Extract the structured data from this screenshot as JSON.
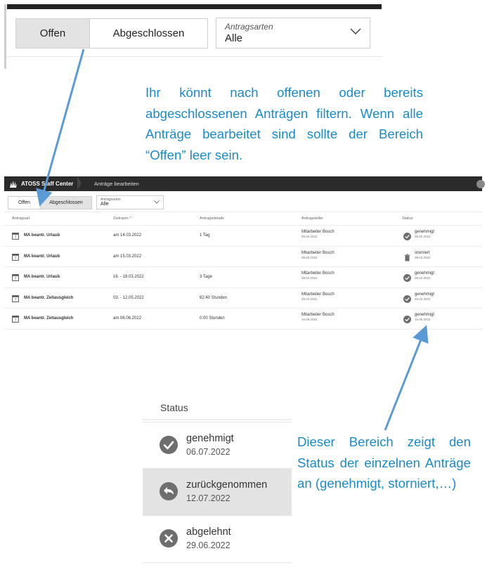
{
  "top_filter": {
    "tab_open": "Offen",
    "tab_closed": "Abgeschlossen",
    "select_label": "Antragsarten",
    "select_value": "Alle"
  },
  "callouts": {
    "filter_note": "Ihr könnt nach offenen oder bereits abgeschlossenen Anträgen filtern. Wenn alle Anträge bearbeitet sind sollte der Bereich “Offen” leer sein.",
    "status_note": "Dieser Bereich zeigt den Status der einzelnen Anträge an (genehmigt, storniert,…)"
  },
  "app": {
    "brand": "ATOSS Staff Center",
    "breadcrumb": "Anträge bearbeiten",
    "filter": {
      "tab_open": "Offen",
      "tab_closed": "Abgeschlossen",
      "select_label": "Antragsarten",
      "select_value": "Alle"
    },
    "columns": [
      "Antragsart",
      "Zeitraum ^",
      "Antragsdetails",
      "Antragsteller",
      "Status"
    ],
    "rows": [
      {
        "type": "MA beantr. Urlaub",
        "period": "am 14.03.2022",
        "details": "1 Tag",
        "requester": "Mitarbeiter Bosch",
        "requester_date": "09.02.2022",
        "status": "genehmigt",
        "status_date": "09.02.2022",
        "status_icon": "check-circle-icon"
      },
      {
        "type": "MA beantr. Urlaub",
        "period": "am 15.03.2022",
        "details": "",
        "requester": "Mitarbeiter Bosch",
        "requester_date": "09.02.2022",
        "status": "storniert",
        "status_date": "09.02.2022",
        "status_icon": "trash-icon"
      },
      {
        "type": "MA beantr. Urlaub",
        "period": "16. - 18.03.2022",
        "details": "3 Tage",
        "requester": "Mitarbeiter Bosch",
        "requester_date": "09.02.2022",
        "status": "genehmigt",
        "status_date": "09.02.2022",
        "status_icon": "check-circle-icon"
      },
      {
        "type": "MA beantr. Zeitausgleich",
        "period": "03. - 12.05.2022",
        "details": "62:40 Stunden",
        "requester": "Mitarbeiter Bosch",
        "requester_date": "29.04.2022",
        "status": "genehmigt",
        "status_date": "29.04.2022",
        "status_icon": "check-circle-icon"
      },
      {
        "type": "MA beantr. Zeitausgleich",
        "period": "am 06.06.2022",
        "details": "0:00 Stunden",
        "requester": "Mitarbeiter Bosch",
        "requester_date": "16.06.2022",
        "status": "genehmigt",
        "status_date": "16.06.2022",
        "status_icon": "check-circle-icon"
      }
    ]
  },
  "status_panel": {
    "header": "Status",
    "items": [
      {
        "label": "genehmigt",
        "date": "06.07.2022",
        "icon": "check-circle-icon"
      },
      {
        "label": "zurückgenommen",
        "date": "12.07.2022",
        "icon": "undo-circle-icon"
      },
      {
        "label": "abgelehnt",
        "date": "29.06.2022",
        "icon": "x-circle-icon"
      }
    ]
  },
  "colors": {
    "callout_text": "#1a8bc8",
    "arrow": "#5b9bd5",
    "titlebar": "#2b2b2b",
    "icon_gray": "#6e6e6e",
    "selected_bg": "#e3e3e3"
  }
}
